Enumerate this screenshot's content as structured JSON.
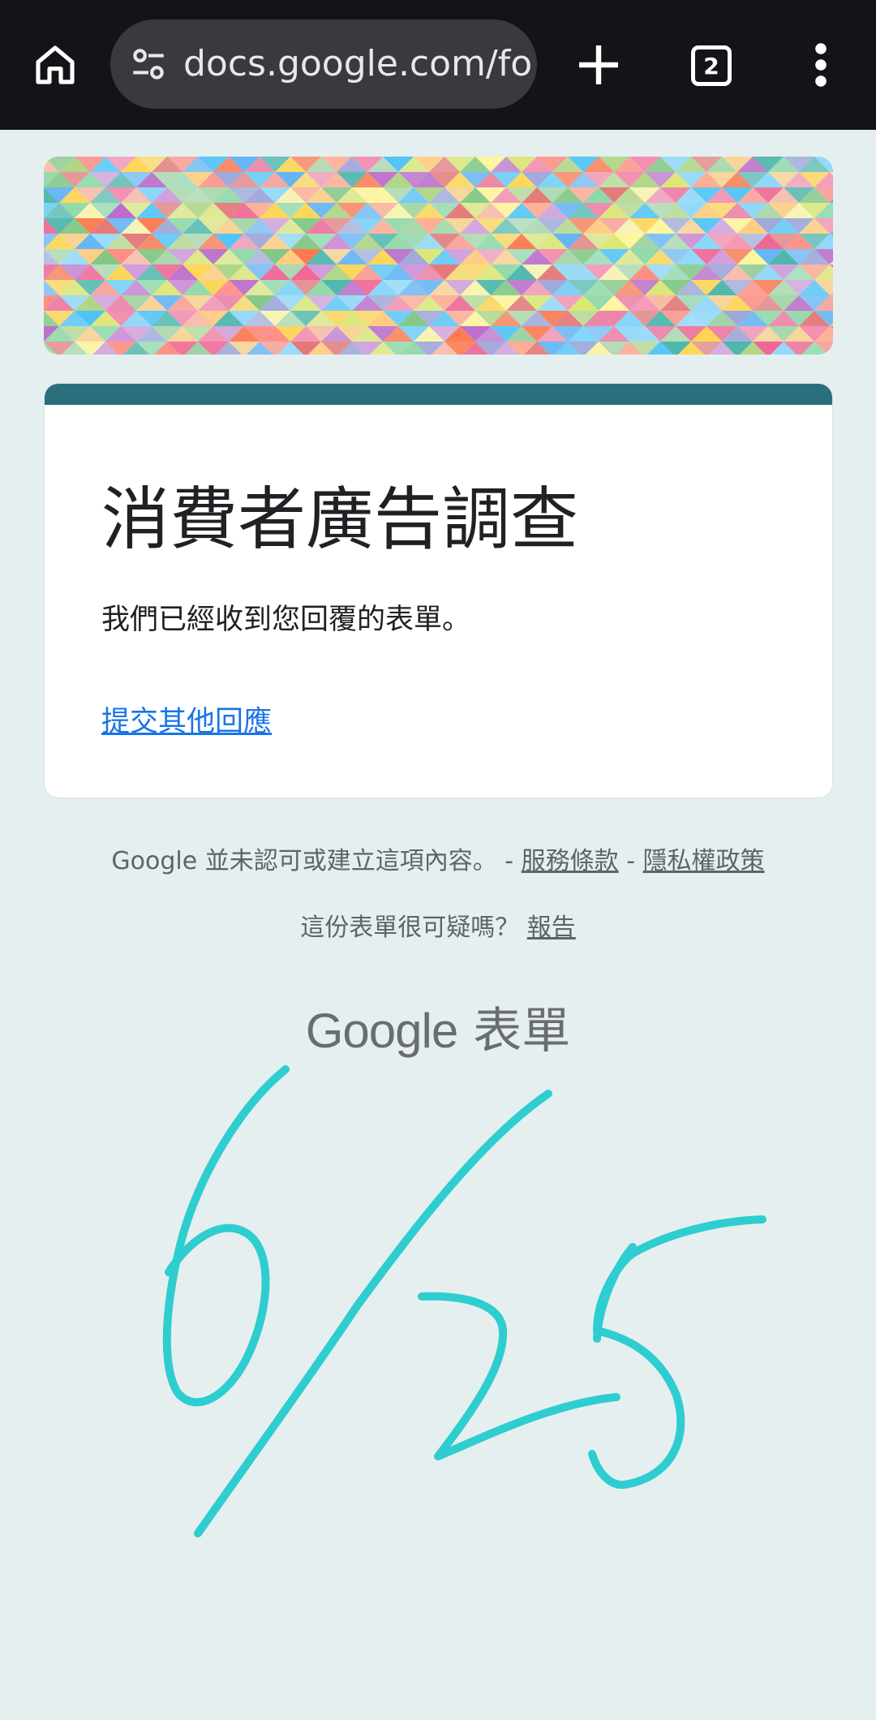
{
  "browser": {
    "url": "docs.google.com/forms",
    "tab_count": "2",
    "icons": {
      "home": "home-icon",
      "site_settings": "tune-icon",
      "new_tab": "plus-icon",
      "tabs": "tab-switcher-icon",
      "menu": "more-vert-icon"
    }
  },
  "form": {
    "title": "消費者廣告調查",
    "confirmation_message": "我們已經收到您回覆的表單。",
    "submit_another_link": "提交其他回應",
    "accent_color": "#2a6f7b",
    "link_color": "#1a73e8"
  },
  "footer": {
    "disclaimer": "Google 並未認可或建立這項內容。 - ",
    "terms_link": "服務條款",
    "separator": " - ",
    "privacy_link": "隱私權政策",
    "report_question": "這份表單很可疑嗎？ ",
    "report_link": "報告",
    "brand_google": "Google",
    "brand_product": " 表單"
  },
  "annotation": {
    "handwritten_note": "6/25",
    "ink_color": "#2ecdd0"
  },
  "colors": {
    "page_background": "#e5eff0",
    "topbar_background": "#141418"
  }
}
